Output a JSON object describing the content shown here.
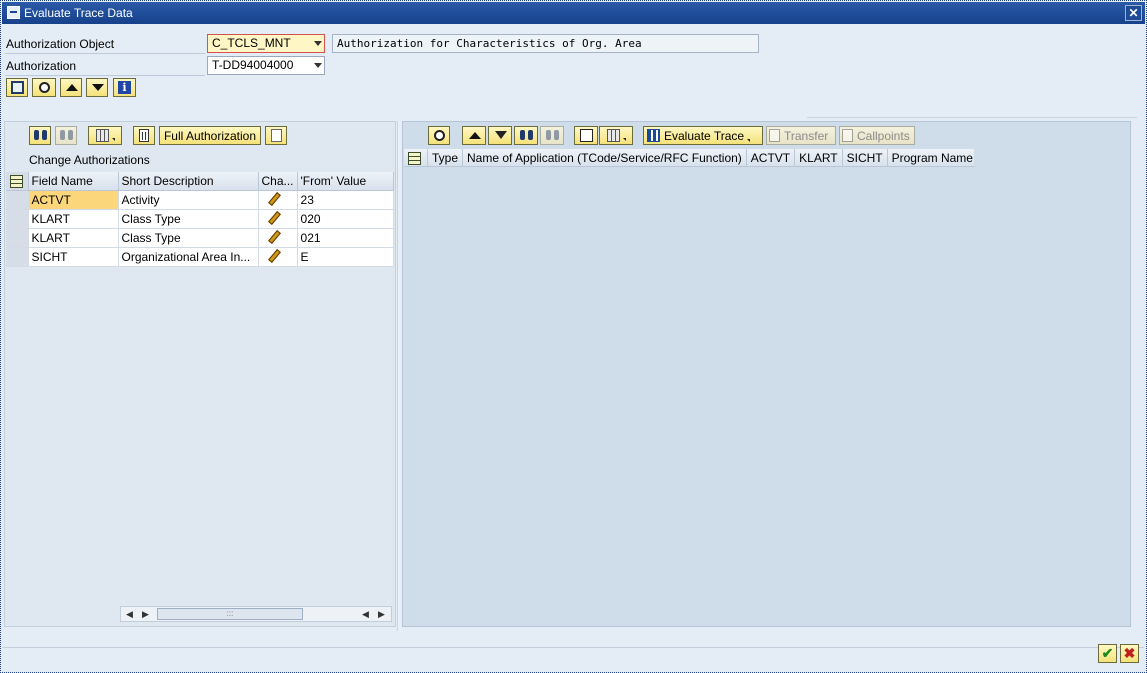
{
  "window": {
    "title": "Evaluate Trace Data"
  },
  "header": {
    "auth_object_label": "Authorization Object",
    "auth_object_value": "C_TCLS_MNT",
    "auth_object_desc": "Authorization for Characteristics of Org. Area",
    "authorization_label": "Authorization",
    "authorization_value": "T-DD94004000"
  },
  "left": {
    "full_auth_label": "Full Authorization",
    "section_title": "Change Authorizations",
    "columns": [
      "Field Name",
      "Short Description",
      "Cha...",
      "'From' Value"
    ],
    "rows": [
      {
        "field": "ACTVT",
        "desc": "Activity",
        "from": "23"
      },
      {
        "field": "KLART",
        "desc": "Class Type",
        "from": "020"
      },
      {
        "field": "KLART",
        "desc": "Class Type",
        "from": "021"
      },
      {
        "field": "SICHT",
        "desc": "Organizational Area In...",
        "from": "E"
      }
    ]
  },
  "right": {
    "evaluate_trace_label": "Evaluate Trace",
    "transfer_label": "Transfer",
    "callpoints_label": "Callpoints",
    "columns": [
      "Type",
      "Name of Application (TCode/Service/RFC Function)",
      "ACTVT",
      "KLART",
      "SICHT",
      "Program Name"
    ]
  },
  "colors": {
    "title_bar": "#16418b",
    "button_fill": "#f4e27a",
    "selected_cell": "#fbd67a",
    "panel_bg": "#cfdce9"
  }
}
